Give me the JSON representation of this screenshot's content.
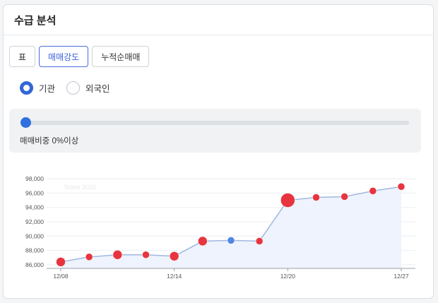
{
  "header": {
    "title": "수급 분석"
  },
  "tabs": [
    {
      "label": "표",
      "active": false
    },
    {
      "label": "매매강도",
      "active": true
    },
    {
      "label": "누적순매매",
      "active": false
    }
  ],
  "radios": [
    {
      "label": "기관",
      "checked": true
    },
    {
      "label": "외국인",
      "checked": false
    }
  ],
  "slider": {
    "value_percent": 0,
    "caption": "매매비중 0%이상"
  },
  "colors": {
    "accent": "#2f6fe0",
    "point_red": "#e8343f",
    "point_blue": "#4f86e6",
    "line": "#9fb8e0",
    "area": "#eef3fd"
  },
  "chart_data": {
    "type": "scatter",
    "watermark": "Tcove 2022",
    "ylim": [
      85500,
      98500
    ],
    "y_ticks": [
      "98,000",
      "96,000",
      "94,000",
      "92,000",
      "90,000",
      "88,000",
      "86,000"
    ],
    "x_tick_labels": [
      "12/08",
      "12/14",
      "12/20",
      "12/27"
    ],
    "grid": true,
    "points": [
      {
        "x": "12/08",
        "y": 86400,
        "size": "medium",
        "color": "red"
      },
      {
        "x": "12/09",
        "y": 87100,
        "size": "small",
        "color": "red"
      },
      {
        "x": "12/12",
        "y": 87400,
        "size": "medium",
        "color": "red"
      },
      {
        "x": "12/13",
        "y": 87400,
        "size": "small",
        "color": "red"
      },
      {
        "x": "12/14",
        "y": 87200,
        "size": "medium",
        "color": "red"
      },
      {
        "x": "12/15",
        "y": 89300,
        "size": "medium",
        "color": "red"
      },
      {
        "x": "12/16",
        "y": 89400,
        "size": "small",
        "color": "blue"
      },
      {
        "x": "12/19",
        "y": 89300,
        "size": "small",
        "color": "red"
      },
      {
        "x": "12/20",
        "y": 95000,
        "size": "large",
        "color": "red"
      },
      {
        "x": "12/21",
        "y": 95400,
        "size": "small",
        "color": "red"
      },
      {
        "x": "12/22",
        "y": 95500,
        "size": "small",
        "color": "red"
      },
      {
        "x": "12/23",
        "y": 96300,
        "size": "small",
        "color": "red"
      },
      {
        "x": "12/27",
        "y": 96900,
        "size": "small",
        "color": "red"
      }
    ]
  }
}
